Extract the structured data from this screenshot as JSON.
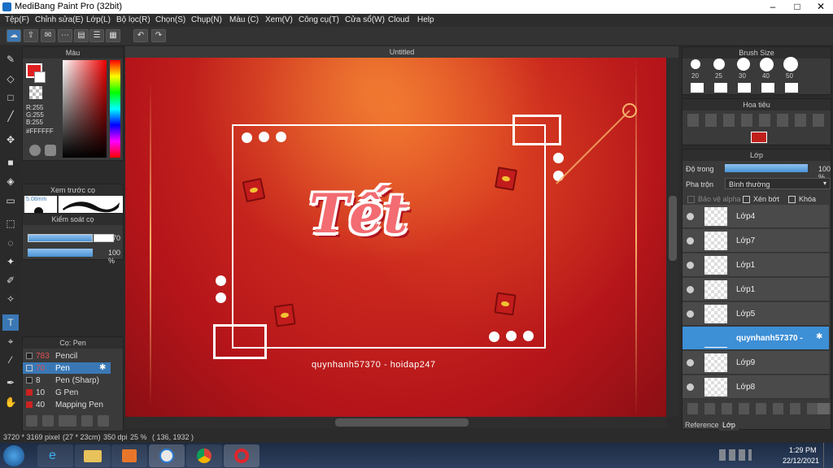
{
  "app": {
    "title": "MediBang Paint Pro (32bit)"
  },
  "menu": [
    "Tệp(F)",
    "Chỉnh sửa(E)",
    "Lớp(L)",
    "Bộ lọc(R)",
    "Chọn(S)",
    "Chụp(N)",
    "Màu (C)",
    "Xem(V)",
    "Công cụ(T)",
    "Cửa sổ(W)",
    "Cloud",
    "Help"
  ],
  "color_panel": {
    "title": "Màu",
    "r": "R:255",
    "g": "G:255",
    "b": "B:255",
    "hex": "#FFFFFF"
  },
  "brush_preview": {
    "title": "Xem trước cọ",
    "size": "5.08mm"
  },
  "brush_control": {
    "title": "Kiểm soát cọ",
    "size_value": "70",
    "opacity_value": "100 %"
  },
  "brush_list": {
    "title": "Cọ: Pen",
    "items": [
      {
        "size": "783",
        "name": "Pencil",
        "color": "#222"
      },
      {
        "size": "70",
        "name": "Pen",
        "color": "#3a78b5"
      },
      {
        "size": "8",
        "name": "Pen (Sharp)",
        "color": "#222"
      },
      {
        "size": "10",
        "name": "G Pen",
        "color": "#cc2222"
      },
      {
        "size": "40",
        "name": "Mapping Pen",
        "color": "#cc2222"
      }
    ]
  },
  "canvas": {
    "tab": "Untitled",
    "word": "Tết",
    "watermark": "quynhanh57370 - hoidap247"
  },
  "brush_size": {
    "title": "Brush Size",
    "sizes": [
      "20",
      "25",
      "30",
      "40",
      "50"
    ]
  },
  "navigator": {
    "title": "Hoa tiêu"
  },
  "layers": {
    "title": "Lớp",
    "opacity_label": "Độ trong",
    "opacity_value": "100 %",
    "blend_label": "Pha trộn",
    "blend_value": "Bình thường",
    "protect_alpha": "Bảo vệ alpha",
    "clipping": "Xén bớt",
    "lock": "Khóa",
    "items": [
      "Lớp4",
      "Lớp7",
      "Lớp1",
      "Lớp1",
      "Lớp5",
      "quynhanh57370 -",
      "Lớp9",
      "Lớp8"
    ],
    "selected_index": 5
  },
  "bottom_tabs": [
    "Reference",
    "Lớp"
  ],
  "status": {
    "size": "3720 * 3169 pixel",
    "cm": "(27 * 23cm)",
    "dpi": "350 dpi",
    "zoom": "25 %",
    "coords": "( 136, 1932 )"
  },
  "clock": {
    "time": "1:29 PM",
    "date": "22/12/2021"
  },
  "colors": {
    "accent": "#3a78b5",
    "canvas_red": "#c0201c"
  }
}
